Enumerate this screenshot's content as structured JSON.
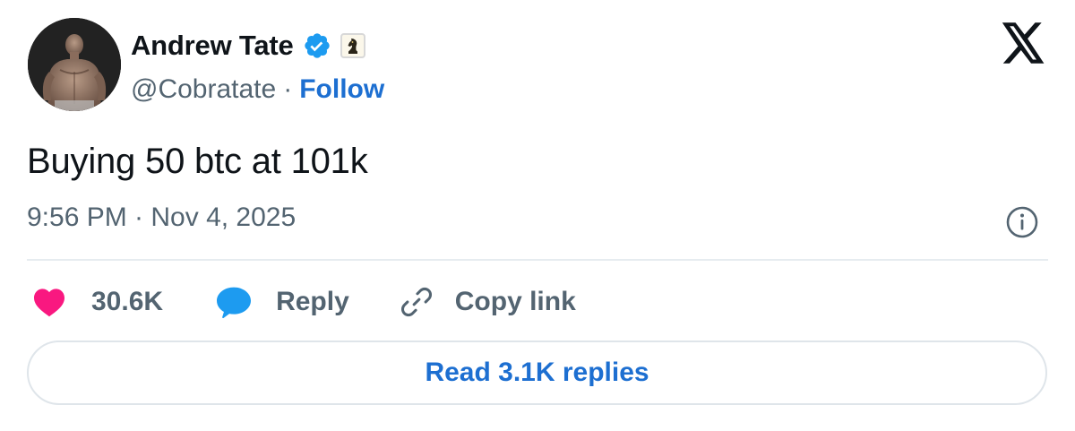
{
  "author": {
    "name": "Andrew Tate",
    "handle": "@Cobratate",
    "separator": "·",
    "follow_label": "Follow",
    "verified_icon": "verified-badge-icon",
    "affiliate_icon": "chess-knight-affiliate-icon"
  },
  "tweet": {
    "text": "Buying 50 btc at 101k",
    "timestamp": "9:56 PM · Nov 4, 2025"
  },
  "actions": {
    "likes": "30.6K",
    "reply_label": "Reply",
    "copy_label": "Copy link"
  },
  "read_replies_label": "Read 3.1K replies",
  "colors": {
    "link_blue": "#1d6fd1",
    "verified_blue": "#1d9bf0",
    "heart_pink": "#f91880",
    "reply_blue": "#1d9bf0",
    "secondary_text": "#536471",
    "primary_text": "#0f1419"
  }
}
